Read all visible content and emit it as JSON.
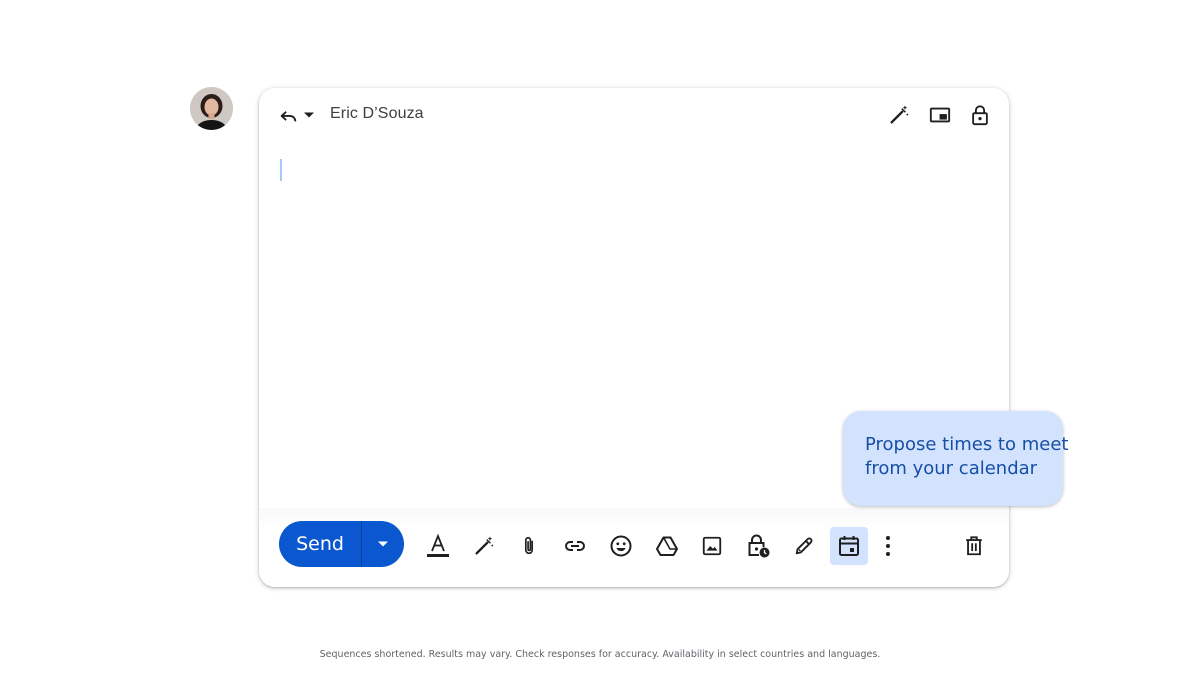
{
  "compose": {
    "recipient": "Eric D’Souza",
    "send_label": "Send"
  },
  "header_icons": [
    "reply-icon",
    "chevron-down-icon",
    "magic-pen-icon",
    "pop-out-icon",
    "lock-icon"
  ],
  "toolbar_icons": [
    "formatting-icon",
    "help-me-write-icon",
    "attach-icon",
    "link-icon",
    "emoji-icon",
    "drive-icon",
    "image-icon",
    "confidential-icon",
    "signature-icon",
    "calendar-icon",
    "more-options-icon",
    "trash-icon"
  ],
  "tooltip": {
    "line1": "Propose times to meet",
    "line2": "from your calendar"
  },
  "disclaimer": "Sequences shortened. Results may vary. Check responses for accuracy. Availability in select countries and languages.",
  "colors": {
    "accent": "#0b57d0",
    "tooltip_bg": "#d3e3fd",
    "icon": "#444746"
  }
}
